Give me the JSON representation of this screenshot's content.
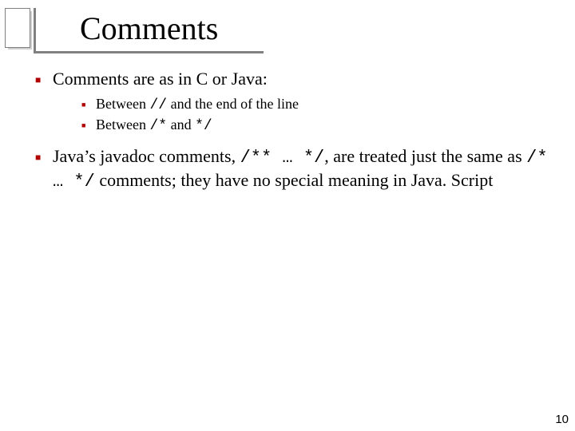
{
  "title": "Comments",
  "p1_text": "Comments are as in C or Java:",
  "sub1_a": "Between ",
  "sub1_code": "//",
  "sub1_b": " and the end of the line",
  "sub2_a": "Between ",
  "sub2_code1": "/*",
  "sub2_mid": " and ",
  "sub2_code2": "*/",
  "p2_a": "Java’s javadoc comments, ",
  "p2_code1": "/** … */",
  "p2_b": ", are treated just the same as ",
  "p2_code2": "/* … */",
  "p2_c": " comments; they have no special meaning in Java. Script",
  "page_number": "10"
}
